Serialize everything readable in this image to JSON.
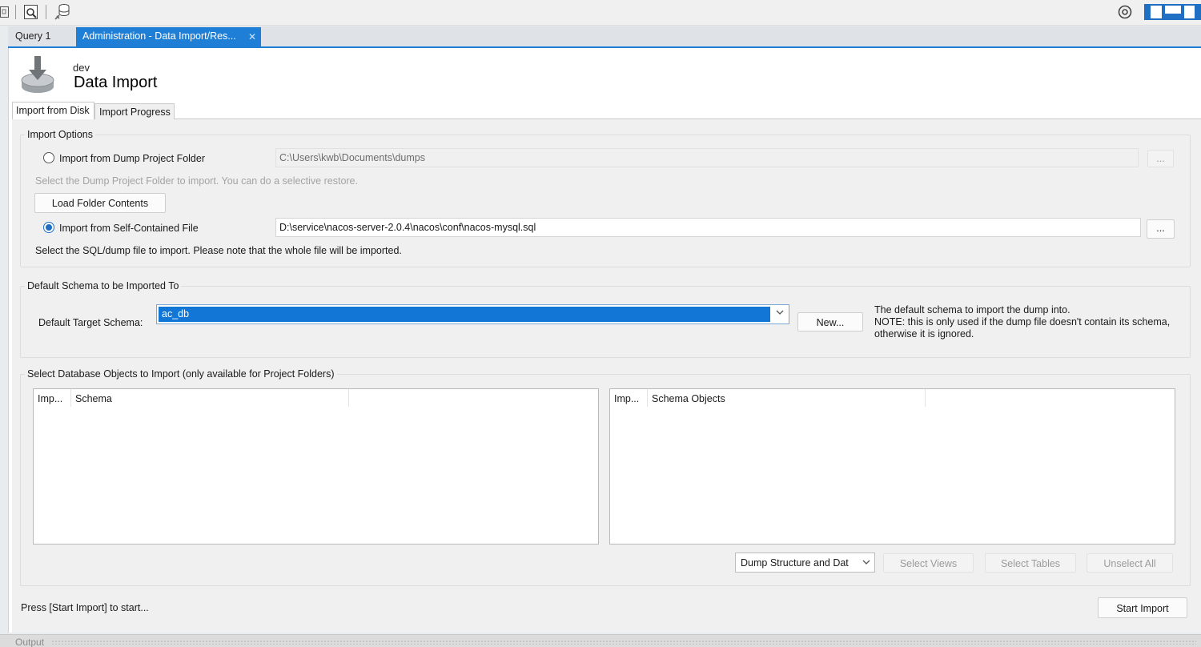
{
  "toolbar": {
    "icons": [
      "panel-icon",
      "inspect-icon",
      "database-icon",
      "settings-gear-icon",
      "layout-left-icon",
      "layout-bottom-icon",
      "layout-right-icon"
    ]
  },
  "tabs": {
    "query": "Query 1",
    "admin": "Administration - Data Import/Res...",
    "close_glyph": "✕"
  },
  "header": {
    "connection": "dev",
    "title": "Data Import"
  },
  "inner_tabs": {
    "from_disk": "Import from Disk",
    "progress": "Import Progress"
  },
  "import_options": {
    "group_title": "Import Options",
    "dump_folder_radio": "Import from Dump Project Folder",
    "dump_folder_path": "C:\\Users\\kwb\\Documents\\dumps",
    "dump_folder_hint": "Select the Dump Project Folder to import. You can do a selective restore.",
    "load_folder_button": "Load Folder Contents",
    "self_contained_radio": "Import from Self-Contained File",
    "self_contained_path": "D:\\service\\nacos-server-2.0.4\\nacos\\conf\\nacos-mysql.sql",
    "self_contained_hint": "Select the SQL/dump file to import. Please note that the whole file will be imported.",
    "browse_label": "...",
    "selected": "self_contained"
  },
  "default_schema": {
    "group_title": "Default Schema to be Imported To",
    "label": "Default Target Schema:",
    "value": "ac_db",
    "new_button": "New...",
    "note_line1": "The default schema to import the dump into.",
    "note_line2": "NOTE: this is only used if the dump file doesn't contain its schema,",
    "note_line3": "otherwise it is ignored."
  },
  "objects": {
    "group_title": "Select Database Objects to Import (only available for Project Folders)",
    "left_columns": [
      "Imp...",
      "Schema"
    ],
    "right_columns": [
      "Imp...",
      "Schema Objects"
    ],
    "dump_mode": "Dump Structure and Dat",
    "select_views": "Select Views",
    "select_tables": "Select Tables",
    "unselect_all": "Unselect All"
  },
  "footer": {
    "status": "Press [Start Import] to start...",
    "start_button": "Start Import"
  },
  "output": {
    "label": "Output"
  }
}
